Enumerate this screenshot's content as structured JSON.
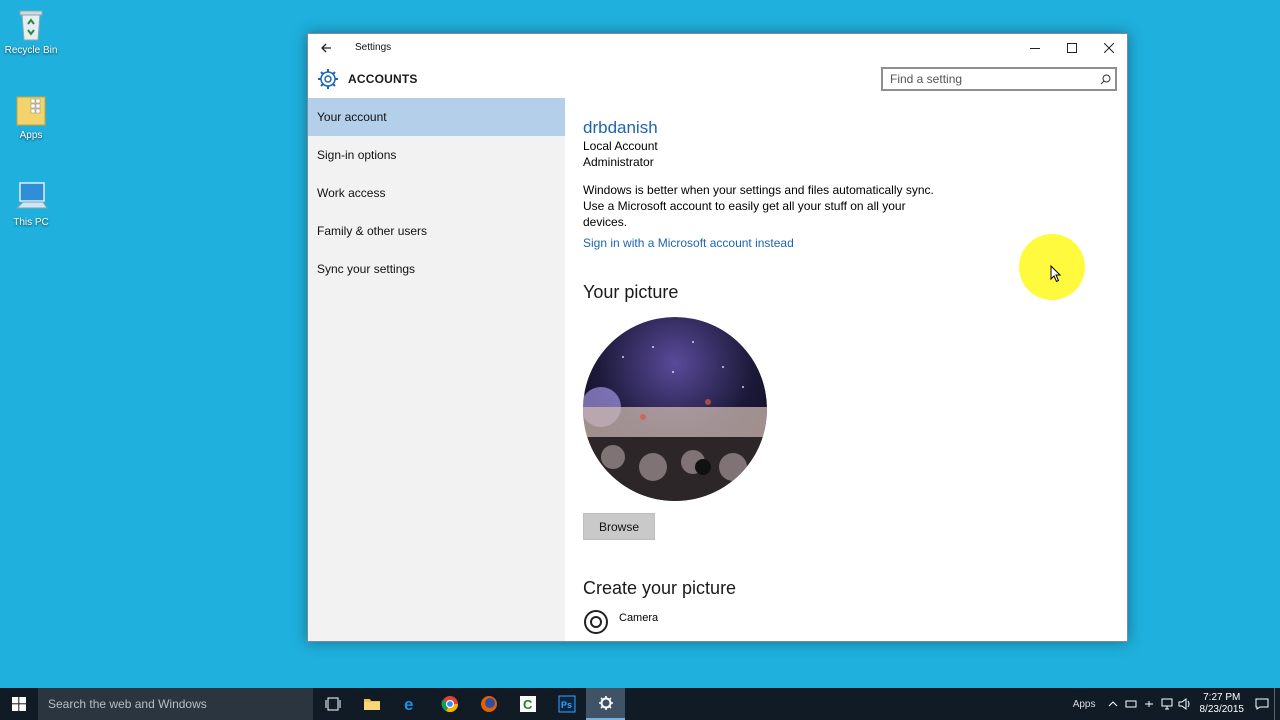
{
  "desktop": {
    "icons": [
      {
        "label": "Recycle Bin"
      },
      {
        "label": "Apps"
      },
      {
        "label": "This PC"
      }
    ]
  },
  "window": {
    "title": "Settings",
    "section": "ACCOUNTS",
    "search_placeholder": "Find a setting"
  },
  "sidebar": {
    "items": [
      {
        "label": "Your account",
        "active": true
      },
      {
        "label": "Sign-in options"
      },
      {
        "label": "Work access"
      },
      {
        "label": "Family & other users"
      },
      {
        "label": "Sync your settings"
      }
    ]
  },
  "account": {
    "username": "drbdanish",
    "type": "Local Account",
    "role": "Administrator",
    "sync_text": "Windows is better when your settings and files automatically sync. Use a Microsoft account to easily get all your stuff on all your devices.",
    "ms_link": "Sign in with a Microsoft account instead"
  },
  "picture": {
    "heading": "Your picture",
    "browse_label": "Browse"
  },
  "create": {
    "heading": "Create your picture",
    "camera_label": "Camera"
  },
  "taskbar": {
    "search_placeholder": "Search the web and Windows",
    "tray_apps": "Apps",
    "time": "7:27 PM",
    "date": "8/23/2015"
  },
  "colors": {
    "desktop": "#1fb0dd",
    "accent_link": "#1d64b3",
    "nav_active": "#b3cfe9",
    "taskbar": "#101b26"
  }
}
